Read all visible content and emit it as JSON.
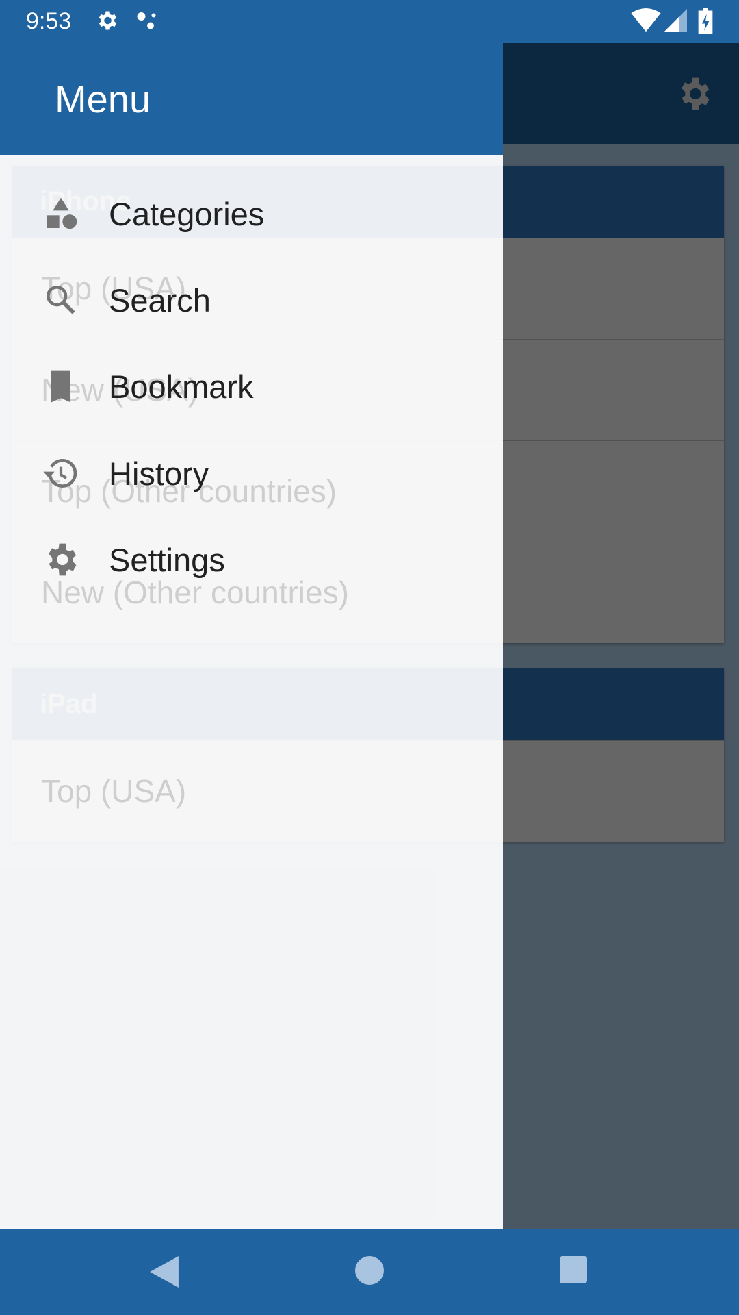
{
  "status_bar": {
    "time": "9:53",
    "icons": [
      "settings-icon",
      "assistant-dots-icon",
      "wifi-icon",
      "signal-icon",
      "battery-charging-icon"
    ]
  },
  "app_bar": {
    "action_icon": "settings-icon"
  },
  "content": {
    "cards": [
      {
        "title": "iPhone",
        "rows": [
          "Top (USA)",
          "New (USA)",
          "Top (Other countries)",
          "New (Other countries)"
        ]
      },
      {
        "title": "iPad",
        "rows": [
          "Top (USA)"
        ]
      }
    ]
  },
  "drawer": {
    "title": "Menu",
    "items": [
      {
        "label": "Categories",
        "icon": "categories-icon"
      },
      {
        "label": "Search",
        "icon": "search-icon"
      },
      {
        "label": "Bookmark",
        "icon": "bookmark-icon"
      },
      {
        "label": "History",
        "icon": "history-icon"
      },
      {
        "label": "Settings",
        "icon": "settings-icon"
      }
    ]
  },
  "nav_bar": {
    "buttons": [
      "back",
      "home",
      "recents"
    ]
  },
  "colors": {
    "primary": "#1f63a0",
    "drawer_bg": "#f5f5f5",
    "icon_gray": "#757575",
    "text": "#212121"
  }
}
